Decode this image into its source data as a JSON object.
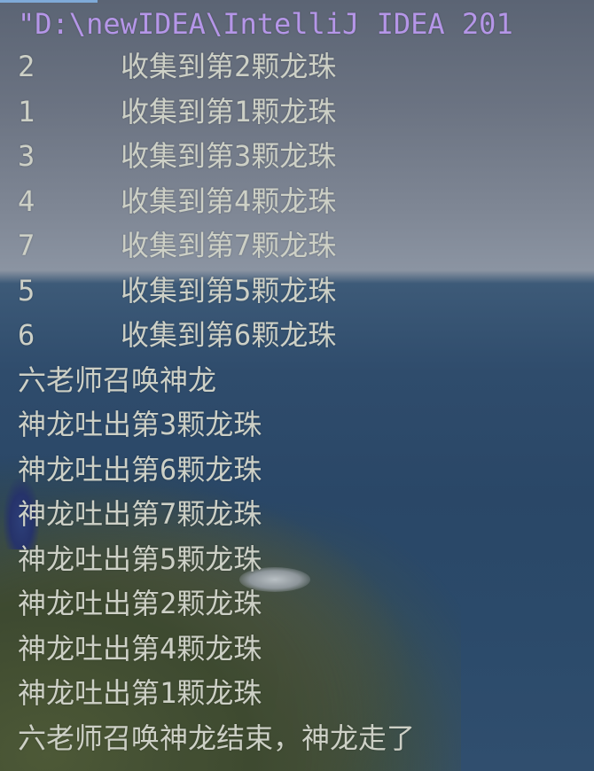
{
  "console": {
    "command_line": "\"D:\\newIDEA\\IntelliJ IDEA 201",
    "collected": [
      {
        "num": "2",
        "text": "收集到第2颗龙珠"
      },
      {
        "num": "1",
        "text": "收集到第1颗龙珠"
      },
      {
        "num": "3",
        "text": "收集到第3颗龙珠"
      },
      {
        "num": "4",
        "text": "收集到第4颗龙珠"
      },
      {
        "num": "7",
        "text": "收集到第7颗龙珠"
      },
      {
        "num": "5",
        "text": "收集到第5颗龙珠"
      },
      {
        "num": "6",
        "text": "收集到第6颗龙珠"
      }
    ],
    "summon_start": "六老师召唤神龙",
    "released": [
      "神龙吐出第3颗龙珠",
      "神龙吐出第6颗龙珠",
      "神龙吐出第7颗龙珠",
      "神龙吐出第5颗龙珠",
      "神龙吐出第2颗龙珠",
      "神龙吐出第4颗龙珠",
      "神龙吐出第1颗龙珠"
    ],
    "summon_end": "六老师召唤神龙结束，神龙走了"
  },
  "colors": {
    "command": "#b596e8",
    "output_text": "#cdd0c6",
    "accent_line": "#7faad8"
  }
}
